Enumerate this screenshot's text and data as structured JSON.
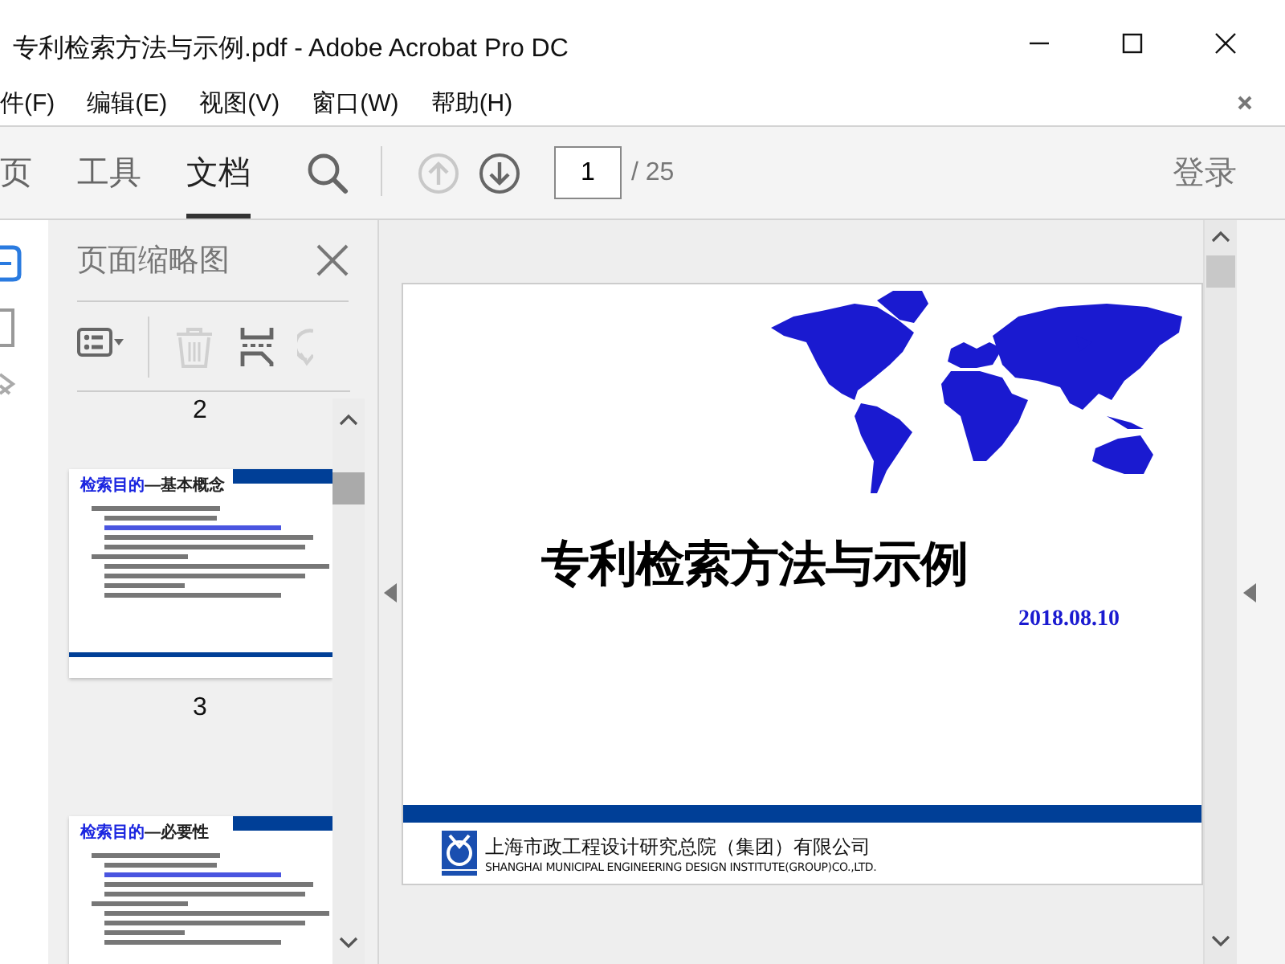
{
  "window": {
    "title": "专利检索方法与示例.pdf - Adobe Acrobat Pro DC"
  },
  "menu": {
    "items": [
      "件(F)",
      "编辑(E)",
      "视图(V)",
      "窗口(W)",
      "帮助(H)"
    ]
  },
  "toolbar": {
    "tabs": [
      {
        "label": "页",
        "selected": false
      },
      {
        "label": "工具",
        "selected": false
      },
      {
        "label": "文档",
        "selected": true
      }
    ],
    "nav_buttons": [
      {
        "kind": "up",
        "disabled": true
      },
      {
        "kind": "down",
        "disabled": false
      }
    ],
    "page_input": {
      "value": "1"
    },
    "page_total": "/ 25",
    "login": "登录"
  },
  "thumbnail_panel": {
    "title": "页面缩略图",
    "tools": [
      {
        "kind": "options",
        "disabled": false
      },
      {
        "kind": "delete",
        "disabled": true
      },
      {
        "kind": "extract",
        "disabled": false
      },
      {
        "kind": "rotate",
        "disabled": true
      }
    ],
    "previous_label": "2",
    "thumbnails": [
      {
        "title": "检索目的",
        "subtitle": "—基本概念",
        "label": "3",
        "selected": false
      },
      {
        "title": "检索目的",
        "subtitle": "—必要性",
        "selected": false
      }
    ]
  },
  "document": {
    "title": "专利检索方法与示例",
    "date": "2018.08.10",
    "company_cn": "上海市政工程设计研究总院（集团）有限公司",
    "company_en": "SHANGHAI MUNICIPAL ENGINEERING DESIGN INSTITUTE(GROUP)CO.,LTD."
  }
}
